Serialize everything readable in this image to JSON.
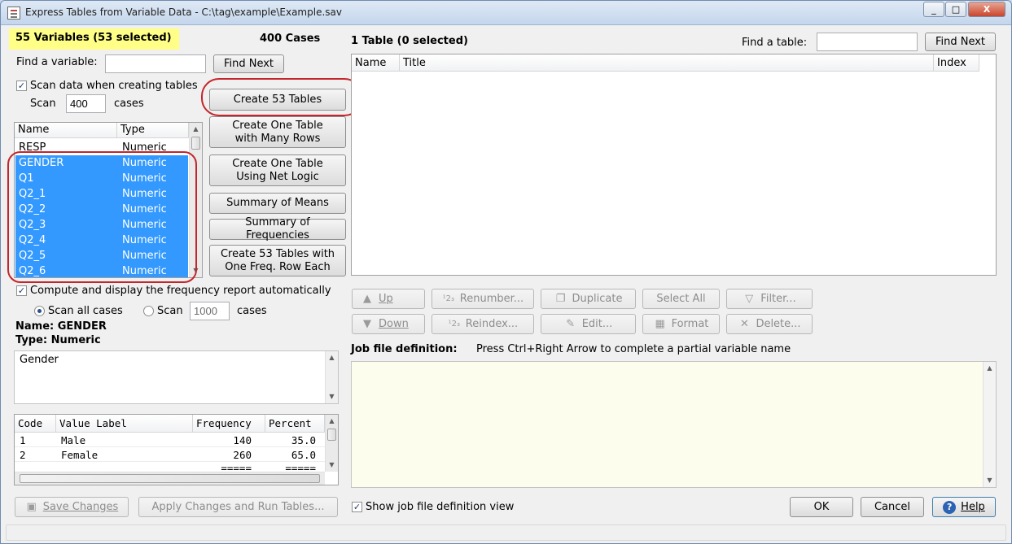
{
  "window": {
    "title": "Express Tables from Variable Data - C:\\tag\\example\\Example.sav",
    "min_label": "_",
    "max_label": "□",
    "close_label": "X"
  },
  "left": {
    "variables_summary": "55 Variables  (53 selected)",
    "cases_summary": "400 Cases",
    "find_variable_label": "Find a variable:",
    "find_variable_value": "",
    "find_next": "Find Next",
    "scan_checkbox_label": "Scan data when creating tables",
    "scan_label": "Scan",
    "scan_value": "400",
    "cases_label": "cases",
    "var_list": {
      "columns": [
        "Name",
        "Type"
      ],
      "rows": [
        {
          "name": "RESP",
          "type": "Numeric",
          "selected": false
        },
        {
          "name": "GENDER",
          "type": "Numeric",
          "selected": true
        },
        {
          "name": "Q1",
          "type": "Numeric",
          "selected": true
        },
        {
          "name": "Q2_1",
          "type": "Numeric",
          "selected": true
        },
        {
          "name": "Q2_2",
          "type": "Numeric",
          "selected": true
        },
        {
          "name": "Q2_3",
          "type": "Numeric",
          "selected": true
        },
        {
          "name": "Q2_4",
          "type": "Numeric",
          "selected": true
        },
        {
          "name": "Q2_5",
          "type": "Numeric",
          "selected": true
        },
        {
          "name": "Q2_6",
          "type": "Numeric",
          "selected": true
        }
      ]
    },
    "freq_checkbox_label": "Compute and display the frequency report automatically",
    "scan_all_label": "Scan all cases",
    "scan2_label": "Scan",
    "scan2_value": "1000",
    "cases2_label": "cases",
    "name_line": "Name: GENDER",
    "type_line": "Type: Numeric",
    "description": "Gender",
    "freq_table": {
      "columns": [
        "Code",
        "Value Label",
        "Frequency",
        "Percent"
      ],
      "rows": [
        {
          "code": "1",
          "label": "Male",
          "freq": "140",
          "pct": "35.0"
        },
        {
          "code": "2",
          "label": "Female",
          "freq": "260",
          "pct": "65.0"
        },
        {
          "code": "",
          "label": "",
          "freq": "=====",
          "pct": "====="
        }
      ]
    },
    "save_changes": "Save Changes",
    "apply_changes": "Apply Changes and Run Tables..."
  },
  "middle": {
    "create_tables": "Create 53 Tables",
    "one_table_many_rows": [
      "Create One Table",
      "with Many Rows"
    ],
    "one_table_net": [
      "Create One Table",
      "Using Net Logic"
    ],
    "summary_means": "Summary of Means",
    "summary_freq": "Summary of Frequencies",
    "tables_one_row": [
      "Create 53 Tables with",
      "One Freq. Row Each"
    ]
  },
  "right": {
    "tables_summary": "1 Table  (0 selected)",
    "find_table_label": "Find a table:",
    "find_table_value": "",
    "find_next": "Find Next",
    "table_columns": [
      "Name",
      "Title",
      "Index"
    ],
    "actions": {
      "up": "Up",
      "renumber": "Renumber...",
      "duplicate": "Duplicate",
      "select_all": "Select All",
      "filter": "Filter...",
      "down": "Down",
      "reindex": "Reindex...",
      "edit": "Edit...",
      "format": "Format",
      "delete": "Delete..."
    },
    "job_label": "Job file definition:",
    "job_hint": "Press Ctrl+Right Arrow to complete a partial variable name",
    "show_job_label": "Show job file definition view",
    "ok": "OK",
    "cancel": "Cancel",
    "help": "Help"
  },
  "icons": {
    "up": "▲",
    "down": "▼",
    "renumber": "¹2₃",
    "reindex": "¹2₃",
    "duplicate": "❐",
    "edit": "✎",
    "filter": "▽",
    "format": "▦",
    "delete": "✕",
    "save": "▣",
    "check": "✓",
    "help": "?"
  },
  "colors": {
    "selection": "#3399ff",
    "highlight": "#ffff88",
    "callout": "#c3262b",
    "job_bg": "#fdfdee"
  }
}
